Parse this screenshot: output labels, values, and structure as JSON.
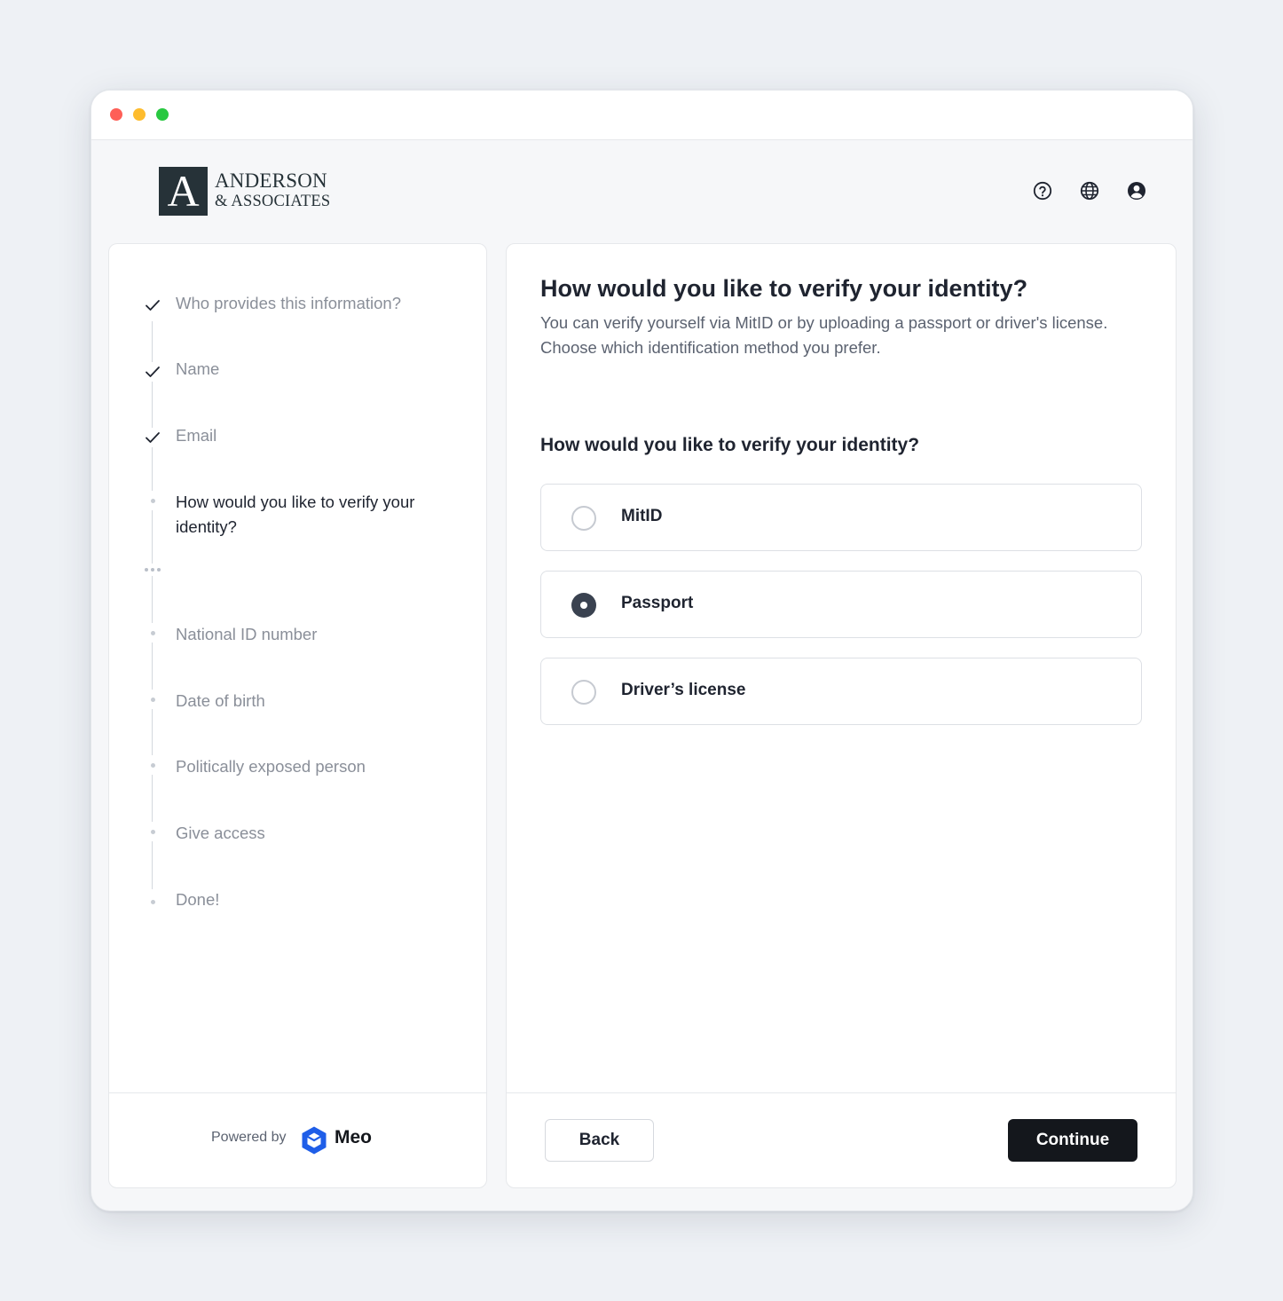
{
  "brand": {
    "initial": "A",
    "line1": "ANDERSON",
    "line2": "& ASSOCIATES"
  },
  "header_icons": [
    "help-circle-icon",
    "globe-icon",
    "user-circle-icon"
  ],
  "steps": [
    {
      "label": "Who provides this information?",
      "status": "done"
    },
    {
      "label": "Name",
      "status": "done"
    },
    {
      "label": "Email",
      "status": "done"
    },
    {
      "label": "How would you like to verify your identity?",
      "status": "active"
    },
    {
      "label": "National ID number",
      "status": "upcoming"
    },
    {
      "label": "Date of birth",
      "status": "upcoming"
    },
    {
      "label": "Politically exposed person",
      "status": "upcoming"
    },
    {
      "label": "Give access",
      "status": "upcoming"
    },
    {
      "label": "Done!",
      "status": "upcoming"
    }
  ],
  "footer": {
    "powered_by": "Powered by",
    "provider": "Meo"
  },
  "main": {
    "title": "How would you like to verify your identity?",
    "description": "You can verify yourself via MitID or by uploading a passport or driver's license. Choose which identification method you prefer.",
    "question": "How would you like to verify your identity?",
    "options": [
      {
        "label": "MitID",
        "selected": false
      },
      {
        "label": "Passport",
        "selected": true
      },
      {
        "label": "Driver’s license",
        "selected": false
      }
    ],
    "back_label": "Back",
    "continue_label": "Continue"
  },
  "colors": {
    "primary_button": "#14171c",
    "brand_mark": "#263238",
    "meo_blue": "#1f5ee8"
  }
}
